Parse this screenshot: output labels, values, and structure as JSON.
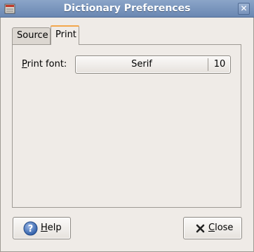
{
  "window": {
    "title": "Dictionary Preferences",
    "close_glyph": "✕"
  },
  "tabs": [
    {
      "label": "Source",
      "active": false
    },
    {
      "label": "Print",
      "active": true
    }
  ],
  "print": {
    "font_label_mnemonic": "P",
    "font_label_rest": "rint font:",
    "font_name": "Serif",
    "font_size": "10"
  },
  "buttons": {
    "help": {
      "mnemonic": "H",
      "rest": "elp",
      "icon": "help-icon"
    },
    "close": {
      "mnemonic": "C",
      "rest": "lose",
      "icon": "close-icon"
    }
  },
  "colors": {
    "titlebar": "#7a96c0",
    "active_tab_accent": "#f3a74b",
    "window_bg": "#efebe7"
  }
}
